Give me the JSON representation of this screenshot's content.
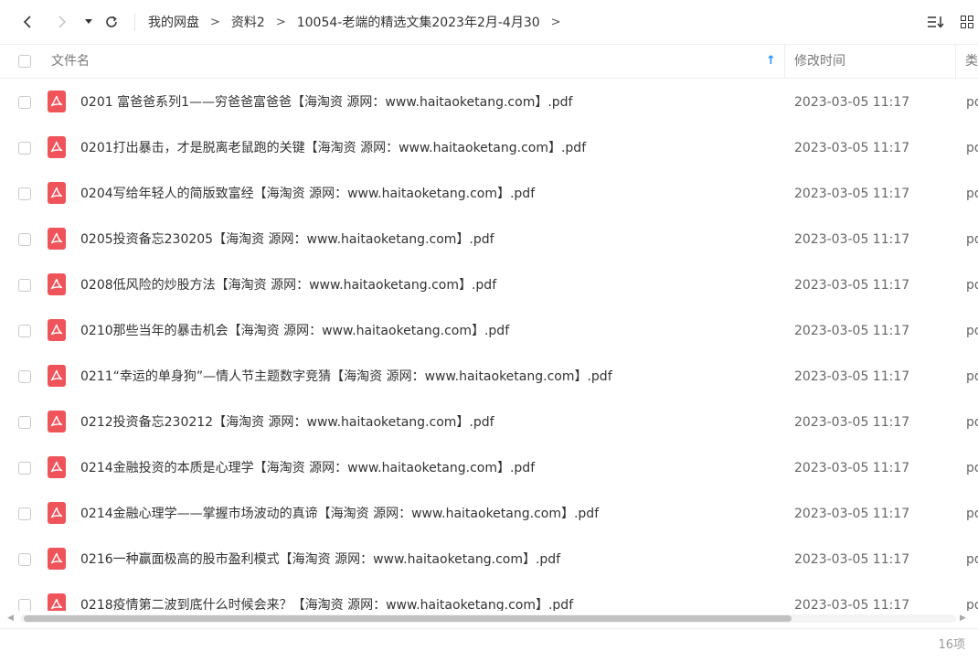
{
  "nav": {
    "back_icon": "chevron-left-icon",
    "forward_icon": "chevron-right-icon",
    "history_icon": "caret-down-icon",
    "refresh_icon": "refresh-icon",
    "breadcrumb": [
      "我的网盘",
      "资料2",
      "10054-老端的精选文集2023年2月-4月30"
    ],
    "crumb_sep": ">"
  },
  "toolbar": {
    "sort_icon": "sort-list-icon",
    "view_icon": "grid-view-icon"
  },
  "columns": {
    "name": "文件名",
    "sort_arrow": "↑",
    "modified": "修改时间",
    "type": "类型"
  },
  "files": [
    {
      "name": "0201 富爸爸系列1——穷爸爸富爸爸【海淘资 源网：www.haitaoketang.com】.pdf",
      "modified": "2023-03-05 11:17",
      "type": "pdf",
      "icon": "pdf-icon"
    },
    {
      "name": "0201打出暴击，才是脱离老鼠跑的关键【海淘资 源网：www.haitaoketang.com】.pdf",
      "modified": "2023-03-05 11:17",
      "type": "pdf",
      "icon": "pdf-icon"
    },
    {
      "name": "0204写给年轻人的简版致富经【海淘资 源网：www.haitaoketang.com】.pdf",
      "modified": "2023-03-05 11:17",
      "type": "pdf",
      "icon": "pdf-icon"
    },
    {
      "name": "0205投资备忘230205【海淘资 源网：www.haitaoketang.com】.pdf",
      "modified": "2023-03-05 11:17",
      "type": "pdf",
      "icon": "pdf-icon"
    },
    {
      "name": "0208低风险的炒股方法【海淘资 源网：www.haitaoketang.com】.pdf",
      "modified": "2023-03-05 11:17",
      "type": "pdf",
      "icon": "pdf-icon"
    },
    {
      "name": "0210那些当年的暴击机会【海淘资 源网：www.haitaoketang.com】.pdf",
      "modified": "2023-03-05 11:17",
      "type": "pdf",
      "icon": "pdf-icon"
    },
    {
      "name": "0211“幸运的单身狗”—情人节主题数字竞猜【海淘资 源网：www.haitaoketang.com】.pdf",
      "modified": "2023-03-05 11:17",
      "type": "pdf",
      "icon": "pdf-icon"
    },
    {
      "name": "0212投资备忘230212【海淘资 源网：www.haitaoketang.com】.pdf",
      "modified": "2023-03-05 11:17",
      "type": "pdf",
      "icon": "pdf-icon"
    },
    {
      "name": "0214金融投资的本质是心理学【海淘资 源网：www.haitaoketang.com】.pdf",
      "modified": "2023-03-05 11:17",
      "type": "pdf",
      "icon": "pdf-icon"
    },
    {
      "name": "0214金融心理学——掌握市场波动的真谛【海淘资 源网：www.haitaoketang.com】.pdf",
      "modified": "2023-03-05 11:17",
      "type": "pdf",
      "icon": "pdf-icon"
    },
    {
      "name": "0216一种赢面极高的股市盈利模式【海淘资 源网：www.haitaoketang.com】.pdf",
      "modified": "2023-03-05 11:17",
      "type": "pdf",
      "icon": "pdf-icon"
    },
    {
      "name": "0218疫情第二波到底什么时候会来？【海淘资 源网：www.haitaoketang.com】.pdf",
      "modified": "2023-03-05 11:17",
      "type": "pdf",
      "icon": "pdf-icon"
    }
  ],
  "footer": {
    "count": "16项"
  },
  "colors": {
    "pdf": "#f0545b",
    "accent": "#1f8fff"
  }
}
